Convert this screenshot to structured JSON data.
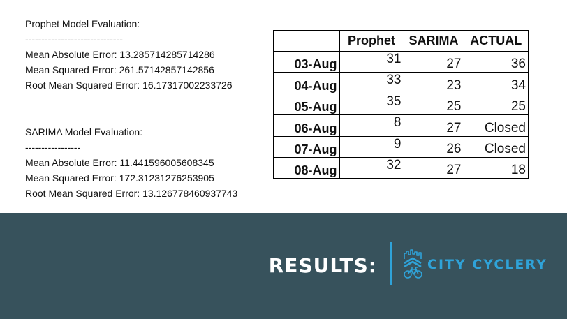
{
  "prophet_eval": {
    "title": "Prophet Model Evaluation:",
    "divider": "------------------------------",
    "mae": "Mean Absolute Error: 13.285714285714286",
    "mse": "Mean Squared Error: 261.57142857142856",
    "rmse": "Root Mean Squared Error: 16.17317002233726"
  },
  "sarima_eval": {
    "title": "SARIMA Model Evaluation:",
    "divider": "-----------------",
    "mae": "Mean Absolute Error: 11.441596005608345",
    "mse": "Mean Squared Error: 172.31231276253905",
    "rmse": "Root Mean Squared Error: 13.126778460937743"
  },
  "table": {
    "headers": [
      "",
      "Prophet",
      "SARIMA",
      "ACTUAL"
    ],
    "rows": [
      {
        "date": "03-Aug",
        "prophet": "31",
        "sarima": "27",
        "actual": "36"
      },
      {
        "date": "04-Aug",
        "prophet": "33",
        "sarima": "23",
        "actual": "34"
      },
      {
        "date": "05-Aug",
        "prophet": "35",
        "sarima": "25",
        "actual": "25"
      },
      {
        "date": "06-Aug",
        "prophet": "8",
        "sarima": "27",
        "actual": "Closed"
      },
      {
        "date": "07-Aug",
        "prophet": "9",
        "sarima": "26",
        "actual": "Closed"
      },
      {
        "date": "08-Aug",
        "prophet": "32",
        "sarima": "27",
        "actual": "18"
      }
    ]
  },
  "footer": {
    "label": "RESULTS:",
    "brand": "CITY CYCLERY",
    "logo_icon": "city-bike-logo-icon",
    "background_color": "#37525c",
    "accent_color": "#2fa3d9"
  }
}
